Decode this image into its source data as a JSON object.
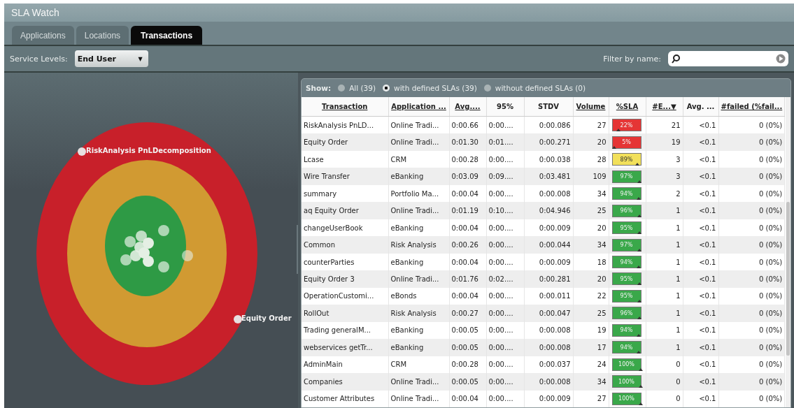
{
  "window": {
    "title": "SLA Watch"
  },
  "tabs": [
    {
      "label": "Applications",
      "selected": false
    },
    {
      "label": "Locations",
      "selected": false
    },
    {
      "label": "Transactions",
      "selected": true
    }
  ],
  "toolbar": {
    "service_levels_label": "Service Levels:",
    "service_level": "End User",
    "dropdown_caret": "▼",
    "filter_label": "Filter by name:"
  },
  "target": {
    "labels": [
      {
        "text": "RiskAnalysis PnLDecomposition"
      },
      {
        "text": "Equity Order"
      }
    ]
  },
  "show": {
    "label": "Show:",
    "options": [
      {
        "label": "All (39)",
        "selected": false
      },
      {
        "label": "with defined SLAs (39)",
        "selected": true
      },
      {
        "label": "without defined SLAs (0)",
        "selected": false
      }
    ]
  },
  "table": {
    "columns": [
      {
        "label": "Transaction",
        "sortable": true
      },
      {
        "label": "Application ...",
        "sortable": true
      },
      {
        "label": "Avg....",
        "sortable": true
      },
      {
        "label": "95%",
        "sortable": false
      },
      {
        "label": "STDV",
        "sortable": false
      },
      {
        "label": "Volume",
        "sortable": true
      },
      {
        "label": "%SLA",
        "sortable": true
      },
      {
        "label": "#E...",
        "sortable": true,
        "sort": "▼"
      },
      {
        "label": "Avg. ...",
        "sortable": false
      },
      {
        "label": "#failed (%fail...",
        "sortable": true
      }
    ],
    "rows": [
      {
        "cells": [
          "RiskAnalysis PnLD...",
          "Online Tradi...",
          "0:00.66",
          "0:00....",
          "0:00.086",
          "27"
        ],
        "sla": {
          "text": "22%",
          "level": 0.22,
          "color": "#e53535"
        },
        "rest": [
          "21",
          "<0.1",
          "0 (0%)"
        ]
      },
      {
        "cells": [
          "Equity Order",
          "Online Tradi...",
          "0:01.30",
          "0:01....",
          "0:00.271",
          "20"
        ],
        "sla": {
          "text": "5%",
          "level": 0.05,
          "color": "#e53535"
        },
        "rest": [
          "19",
          "<0.1",
          "0 (0%)"
        ]
      },
      {
        "cells": [
          "Lcase",
          "CRM",
          "0:00.28",
          "0:00....",
          "0:00.038",
          "28"
        ],
        "sla": {
          "text": "89%",
          "level": 0.89,
          "color": "#f2e05a"
        },
        "rest": [
          "3",
          "<0.1",
          "0 (0%)"
        ]
      },
      {
        "cells": [
          "Wire Transfer",
          "eBanking",
          "0:03.09",
          "0:09....",
          "0:03.481",
          "109"
        ],
        "sla": {
          "text": "97%",
          "level": 0.97,
          "color": "#3aa84a"
        },
        "rest": [
          "3",
          "<0.1",
          "0 (0%)"
        ]
      },
      {
        "cells": [
          "summary",
          "Portfolio Ma...",
          "0:00.04",
          "0:00....",
          "0:00.008",
          "34"
        ],
        "sla": {
          "text": "94%",
          "level": 0.94,
          "color": "#3aa84a"
        },
        "rest": [
          "2",
          "<0.1",
          "0 (0%)"
        ]
      },
      {
        "cells": [
          "aq Equity Order",
          "Online Tradi...",
          "0:01.19",
          "0:10....",
          "0:04.946",
          "25"
        ],
        "sla": {
          "text": "96%",
          "level": 0.96,
          "color": "#3aa84a"
        },
        "rest": [
          "1",
          "<0.1",
          "0 (0%)"
        ]
      },
      {
        "cells": [
          "changeUserBook",
          "eBanking",
          "0:00.04",
          "0:00....",
          "0:00.009",
          "20"
        ],
        "sla": {
          "text": "95%",
          "level": 0.95,
          "color": "#3aa84a"
        },
        "rest": [
          "1",
          "<0.1",
          "0 (0%)"
        ]
      },
      {
        "cells": [
          "Common",
          "Risk Analysis",
          "0:00.26",
          "0:00....",
          "0:00.044",
          "34"
        ],
        "sla": {
          "text": "97%",
          "level": 0.97,
          "color": "#3aa84a"
        },
        "rest": [
          "1",
          "<0.1",
          "0 (0%)"
        ]
      },
      {
        "cells": [
          "counterParties",
          "eBanking",
          "0:00.04",
          "0:00....",
          "0:00.009",
          "18"
        ],
        "sla": {
          "text": "94%",
          "level": 0.94,
          "color": "#3aa84a"
        },
        "rest": [
          "1",
          "<0.1",
          "0 (0%)"
        ]
      },
      {
        "cells": [
          "Equity Order 3",
          "Online Tradi...",
          "0:01.76",
          "0:02....",
          "0:00.281",
          "20"
        ],
        "sla": {
          "text": "95%",
          "level": 0.95,
          "color": "#3aa84a"
        },
        "rest": [
          "1",
          "<0.1",
          "0 (0%)"
        ]
      },
      {
        "cells": [
          "OperationCustomi...",
          "eBonds",
          "0:00.04",
          "0:00....",
          "0:00.011",
          "22"
        ],
        "sla": {
          "text": "95%",
          "level": 0.95,
          "color": "#3aa84a"
        },
        "rest": [
          "1",
          "<0.1",
          "0 (0%)"
        ]
      },
      {
        "cells": [
          "RollOut",
          "Risk Analysis",
          "0:00.27",
          "0:00....",
          "0:00.047",
          "25"
        ],
        "sla": {
          "text": "96%",
          "level": 0.96,
          "color": "#3aa84a"
        },
        "rest": [
          "1",
          "<0.1",
          "0 (0%)"
        ]
      },
      {
        "cells": [
          "Trading generalM...",
          "eBanking",
          "0:00.05",
          "0:00....",
          "0:00.008",
          "19"
        ],
        "sla": {
          "text": "94%",
          "level": 0.94,
          "color": "#3aa84a"
        },
        "rest": [
          "1",
          "<0.1",
          "0 (0%)"
        ]
      },
      {
        "cells": [
          "webservices getTr...",
          "eBanking",
          "0:00.05",
          "0:00....",
          "0:00.008",
          "17"
        ],
        "sla": {
          "text": "94%",
          "level": 0.94,
          "color": "#3aa84a"
        },
        "rest": [
          "1",
          "<0.1",
          "0 (0%)"
        ]
      },
      {
        "cells": [
          "AdminMain",
          "CRM",
          "0:00.28",
          "0:00....",
          "0:00.037",
          "24"
        ],
        "sla": {
          "text": "100%",
          "level": 1,
          "color": "#3aa84a"
        },
        "rest": [
          "0",
          "<0.1",
          "0 (0%)"
        ]
      },
      {
        "cells": [
          "Companies",
          "Online Tradi...",
          "0:00.05",
          "0:00....",
          "0:00.008",
          "34"
        ],
        "sla": {
          "text": "100%",
          "level": 1,
          "color": "#3aa84a"
        },
        "rest": [
          "0",
          "<0.1",
          "0 (0%)"
        ]
      },
      {
        "cells": [
          "Customer Attributes",
          "Online Tradi...",
          "0:00.04",
          "0:00....",
          "0:00.009",
          "27"
        ],
        "sla": {
          "text": "100%",
          "level": 1,
          "color": "#3aa84a"
        },
        "rest": [
          "0",
          "<0.1",
          "0 (0%)"
        ]
      }
    ]
  }
}
